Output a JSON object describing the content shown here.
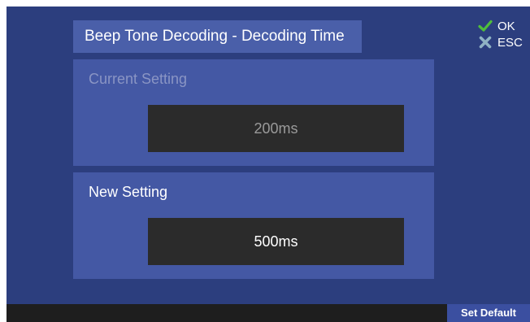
{
  "screen": {
    "title": "Beep Tone Decoding - Decoding Time"
  },
  "current_setting": {
    "label": "Current Setting",
    "value": "200ms"
  },
  "new_setting": {
    "label": "New Setting",
    "value": "500ms"
  },
  "softkeys": {
    "ok": {
      "label": "OK",
      "icon": "checkmark-icon",
      "color": "#4fbf3a"
    },
    "esc": {
      "label": "ESC",
      "icon": "cross-icon",
      "color": "#8fb2c4"
    }
  },
  "bottom_bar": {
    "set_default_label": "Set Default"
  },
  "colors": {
    "background": "#2c3e7e",
    "panel": "#4458a4",
    "value_box": "#2b2b2b",
    "button": "#3b4fa0"
  }
}
